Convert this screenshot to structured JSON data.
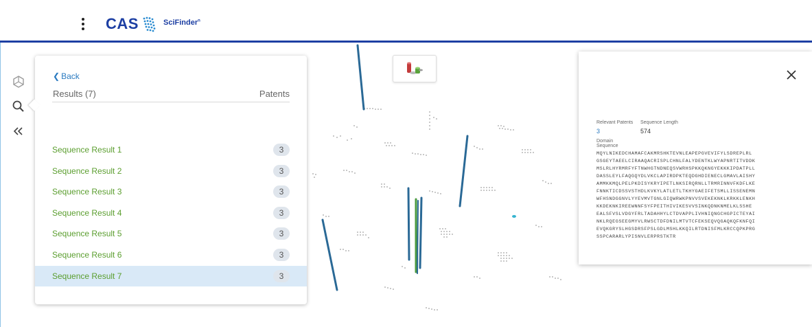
{
  "header": {
    "brand": "CAS",
    "product": "SciFinder",
    "product_sup": "n"
  },
  "sidebar": {
    "icons": [
      "structure-icon",
      "search-icon",
      "collapse-icon"
    ]
  },
  "results_panel": {
    "back_label": "Back",
    "title": "Results (7)",
    "patents_header": "Patents",
    "items": [
      {
        "label": "Sequence Result 1",
        "count": "3"
      },
      {
        "label": "Sequence Result 2",
        "count": "3"
      },
      {
        "label": "Sequence Result 3",
        "count": "3"
      },
      {
        "label": "Sequence Result 4",
        "count": "3"
      },
      {
        "label": "Sequence Result 5",
        "count": "3"
      },
      {
        "label": "Sequence Result 6",
        "count": "3"
      },
      {
        "label": "Sequence Result 7",
        "count": "3"
      }
    ],
    "selected_index": 6
  },
  "detail_panel": {
    "relevant_patents_label": "Relevant Patents",
    "relevant_patents_value": "3",
    "sequence_length_label": "Sequence Length",
    "sequence_length_value": "574",
    "domain_label": "Domain",
    "sequence_label": "Sequence",
    "sequence_lines": [
      "MQYLNIKEDCHAMAFCAKMRSHKTEVNLEAPEPGVEVIFYLSDREPLRL",
      "GSGEYTAEELCIRAAQACRISPLCHNLFALYDENTKLWYAPNRTITVDDK",
      "MSLRLHYRMRFYFTNWHGTNDNEQSVWRHSPKKQKNGYEKKKIPDATPLL",
      "DASSLEYLFAQGQYDLVKCLAPIRDPKTEQDGHDIENECLGMAVLAISHY",
      "AMMKKMQLPELPKDISYKRYIPETLNKSIRQRNLLTRMRINNVFKDFLKE",
      "FNNKTICDSSVSTHDLKVKYLATLETLTKHYGAEIFETSMLLISSENEMN",
      "WFHSNDGGNVLYYEVMVTGNLGIQWRWKPNVVSVEKEKNKLKRKKLENKH",
      "KKDEKNKIREEWNNFSYFPEITHIVIKESVVSINKQDNKNMELKLSSHE",
      "EALSFVSLVDGYFRLTADAHHYLCTDVAPPLIVHNIQNGCHGPICTEYAI",
      "NKLRQEGSEEGMYVLRWSCTDFDNILMTVTCFEKSEQVQGAQKQFKNFQI",
      "EVQKGRYSLHGSDRSFPSLGDLMSHLKKQILRTDNISFMLKRCCQPKPRG",
      "SSPCARARLYPISNVLERPRSTKTR"
    ]
  },
  "colors": {
    "brand_blue": "#1d3fa3",
    "link_blue": "#2a7ac0",
    "result_green": "#5b9e2f",
    "selected_bg": "#d9e9f7"
  }
}
